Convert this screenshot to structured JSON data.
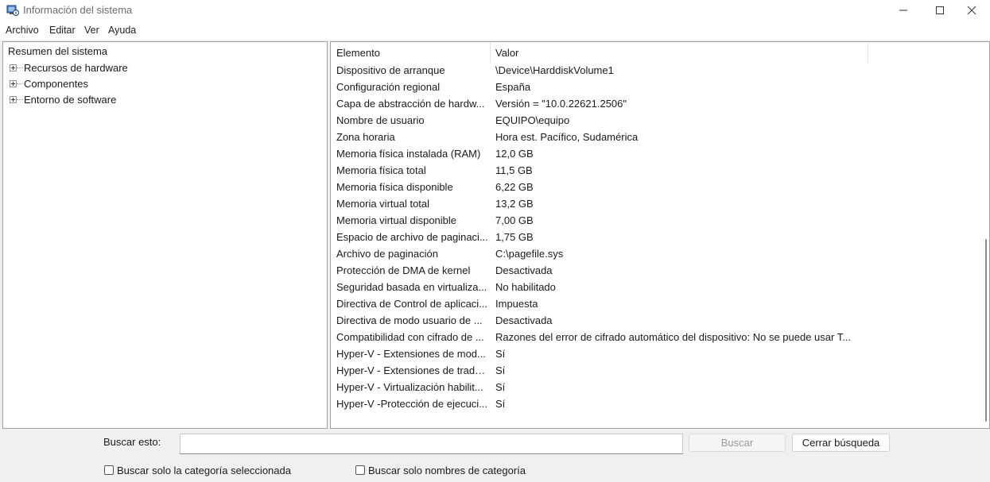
{
  "window": {
    "title": "Información del sistema",
    "controls": {
      "minimize": "minimize-icon",
      "maximize": "maximize-icon",
      "close": "close-icon"
    }
  },
  "menu": [
    "Archivo",
    "Editar",
    "Ver",
    "Ayuda"
  ],
  "tree": {
    "root": "Resumen del sistema",
    "children": [
      "Recursos de hardware",
      "Componentes",
      "Entorno de software"
    ]
  },
  "list": {
    "columns": [
      "Elemento",
      "Valor"
    ],
    "rows": [
      {
        "name": "Dispositivo de arranque",
        "value": "\\Device\\HarddiskVolume1"
      },
      {
        "name": "Configuración regional",
        "value": "España"
      },
      {
        "name": "Capa de abstracción de hardw...",
        "value": "Versión = \"10.0.22621.2506\""
      },
      {
        "name": "Nombre de usuario",
        "value": "EQUIPO\\equipo"
      },
      {
        "name": "Zona horaria",
        "value": "Hora est. Pacífico, Sudamérica"
      },
      {
        "name": "Memoria física instalada (RAM)",
        "value": "12,0 GB"
      },
      {
        "name": "Memoria física total",
        "value": "11,5 GB"
      },
      {
        "name": "Memoria física disponible",
        "value": "6,22 GB"
      },
      {
        "name": "Memoria virtual total",
        "value": "13,2 GB"
      },
      {
        "name": "Memoria virtual disponible",
        "value": "7,00 GB"
      },
      {
        "name": "Espacio de archivo de paginaci...",
        "value": "1,75 GB"
      },
      {
        "name": "Archivo de paginación",
        "value": "C:\\pagefile.sys"
      },
      {
        "name": "Protección de DMA de kernel",
        "value": "Desactivada"
      },
      {
        "name": "Seguridad basada en virtualiza...",
        "value": "No habilitado"
      },
      {
        "name": "Directiva de Control de aplicaci...",
        "value": "Impuesta"
      },
      {
        "name": "Directiva de modo usuario de ...",
        "value": "Desactivada"
      },
      {
        "name": "Compatibilidad con cifrado de ...",
        "value": "Razones del error de cifrado automático del dispositivo: No se puede usar T..."
      },
      {
        "name": "Hyper-V - Extensiones de mod...",
        "value": "Sí"
      },
      {
        "name": "Hyper-V - Extensiones de tradu...",
        "value": "Sí"
      },
      {
        "name": "Hyper-V - Virtualización habilit...",
        "value": "Sí"
      },
      {
        "name": "Hyper-V -Protección de ejecuci...",
        "value": "Sí"
      }
    ]
  },
  "search": {
    "label": "Buscar esto:",
    "value": "",
    "find_button": "Buscar",
    "close_button": "Cerrar búsqueda",
    "check_selected_category": "Buscar solo la categoría seleccionada",
    "check_category_names": "Buscar solo nombres de categoría"
  }
}
